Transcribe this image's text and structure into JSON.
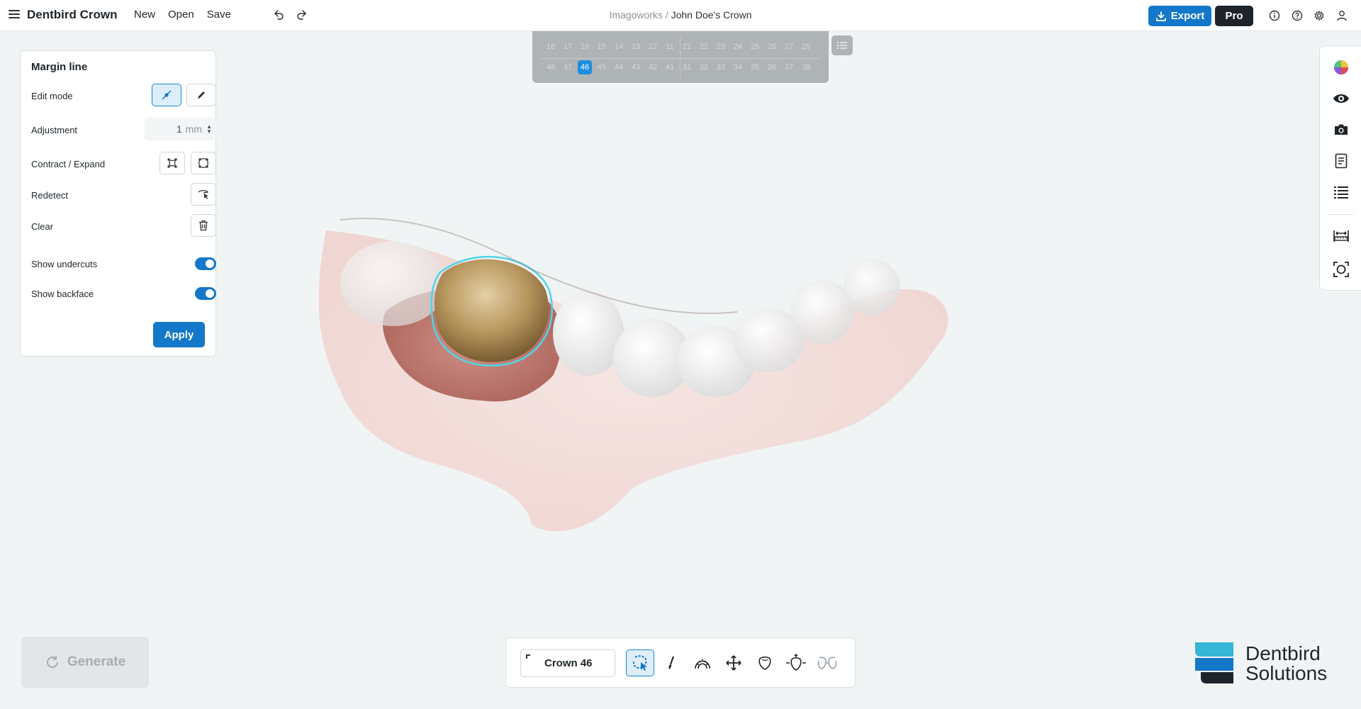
{
  "app": {
    "title": "Dentbird Crown",
    "menu": [
      "New",
      "Open",
      "Save"
    ],
    "breadcrumb": {
      "org": "Imagoworks",
      "separator": " / ",
      "project": "John Doe's Crown"
    },
    "export_label": "Export",
    "pro_label": "Pro"
  },
  "tooth_chart": {
    "upper": [
      "18",
      "17",
      "16",
      "15",
      "14",
      "13",
      "12",
      "11",
      "21",
      "22",
      "23",
      "24",
      "25",
      "26",
      "27",
      "28"
    ],
    "lower": [
      "48",
      "47",
      "46",
      "45",
      "44",
      "43",
      "42",
      "41",
      "31",
      "32",
      "33",
      "34",
      "35",
      "36",
      "37",
      "38"
    ],
    "selected": "46"
  },
  "panel": {
    "title": "Margin line",
    "edit_mode_label": "Edit mode",
    "adjustment_label": "Adjustment",
    "adjustment_value": "1",
    "adjustment_unit": "mm",
    "contract_expand_label": "Contract / Expand",
    "redetect_label": "Redetect",
    "clear_label": "Clear",
    "show_undercuts_label": "Show undercuts",
    "show_undercuts": true,
    "show_backface_label": "Show backface",
    "show_backface": true,
    "apply_label": "Apply"
  },
  "right_bar": {
    "icons": [
      "color-wheel-icon",
      "eye-icon",
      "camera-icon",
      "document-icon",
      "list-icon",
      "ruler-icon",
      "focus-icon"
    ]
  },
  "bottom": {
    "generate_label": "Generate",
    "crown_label": "Crown 46",
    "tools": [
      "margin-select-icon",
      "brush-icon",
      "arch-icon",
      "move-icon",
      "crown-icon",
      "crown-adjust-icon",
      "contact-icon"
    ]
  },
  "brand": {
    "line1": "Dentbird",
    "line2": "Solutions",
    "accent": "#1378c9",
    "accent_light": "#36b6d6"
  }
}
